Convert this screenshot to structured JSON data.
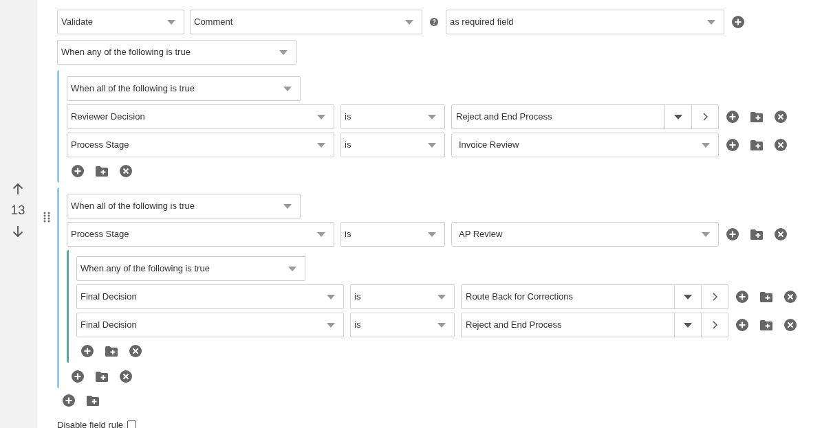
{
  "rule_number": "13",
  "action": {
    "value": "Validate"
  },
  "field": {
    "value": "Comment"
  },
  "requirement": {
    "value": "as required field"
  },
  "root": {
    "match": "When any of the following is true",
    "items": [
      {
        "kind": "group",
        "color": "#81cdf5",
        "match": "When all of the following is true",
        "items": [
          {
            "kind": "condition",
            "field": "Reviewer Decision",
            "operator": "is",
            "value": {
              "kind": "split",
              "text": "Reject and End Process"
            }
          },
          {
            "kind": "condition",
            "field": "Process Stage",
            "operator": "is",
            "value": {
              "kind": "select",
              "text": "Invoice Review"
            }
          }
        ]
      },
      {
        "kind": "group",
        "color": "#81cdf5",
        "match": "When all of the following is true",
        "items": [
          {
            "kind": "condition",
            "field": "Process Stage",
            "operator": "is",
            "value": {
              "kind": "select",
              "text": "AP Review"
            }
          },
          {
            "kind": "group",
            "color": "#3cb4a4",
            "match": "When any of the following is true",
            "items": [
              {
                "kind": "condition",
                "field": "Final Decision",
                "operator": "is",
                "value": {
                  "kind": "split",
                  "text": "Route Back for Corrections"
                }
              },
              {
                "kind": "condition",
                "field": "Final Decision",
                "operator": "is",
                "value": {
                  "kind": "split",
                  "text": "Reject and End Process"
                }
              }
            ]
          }
        ]
      }
    ]
  },
  "disable_field_rule": {
    "label": "Disable field rule",
    "checked": false
  }
}
